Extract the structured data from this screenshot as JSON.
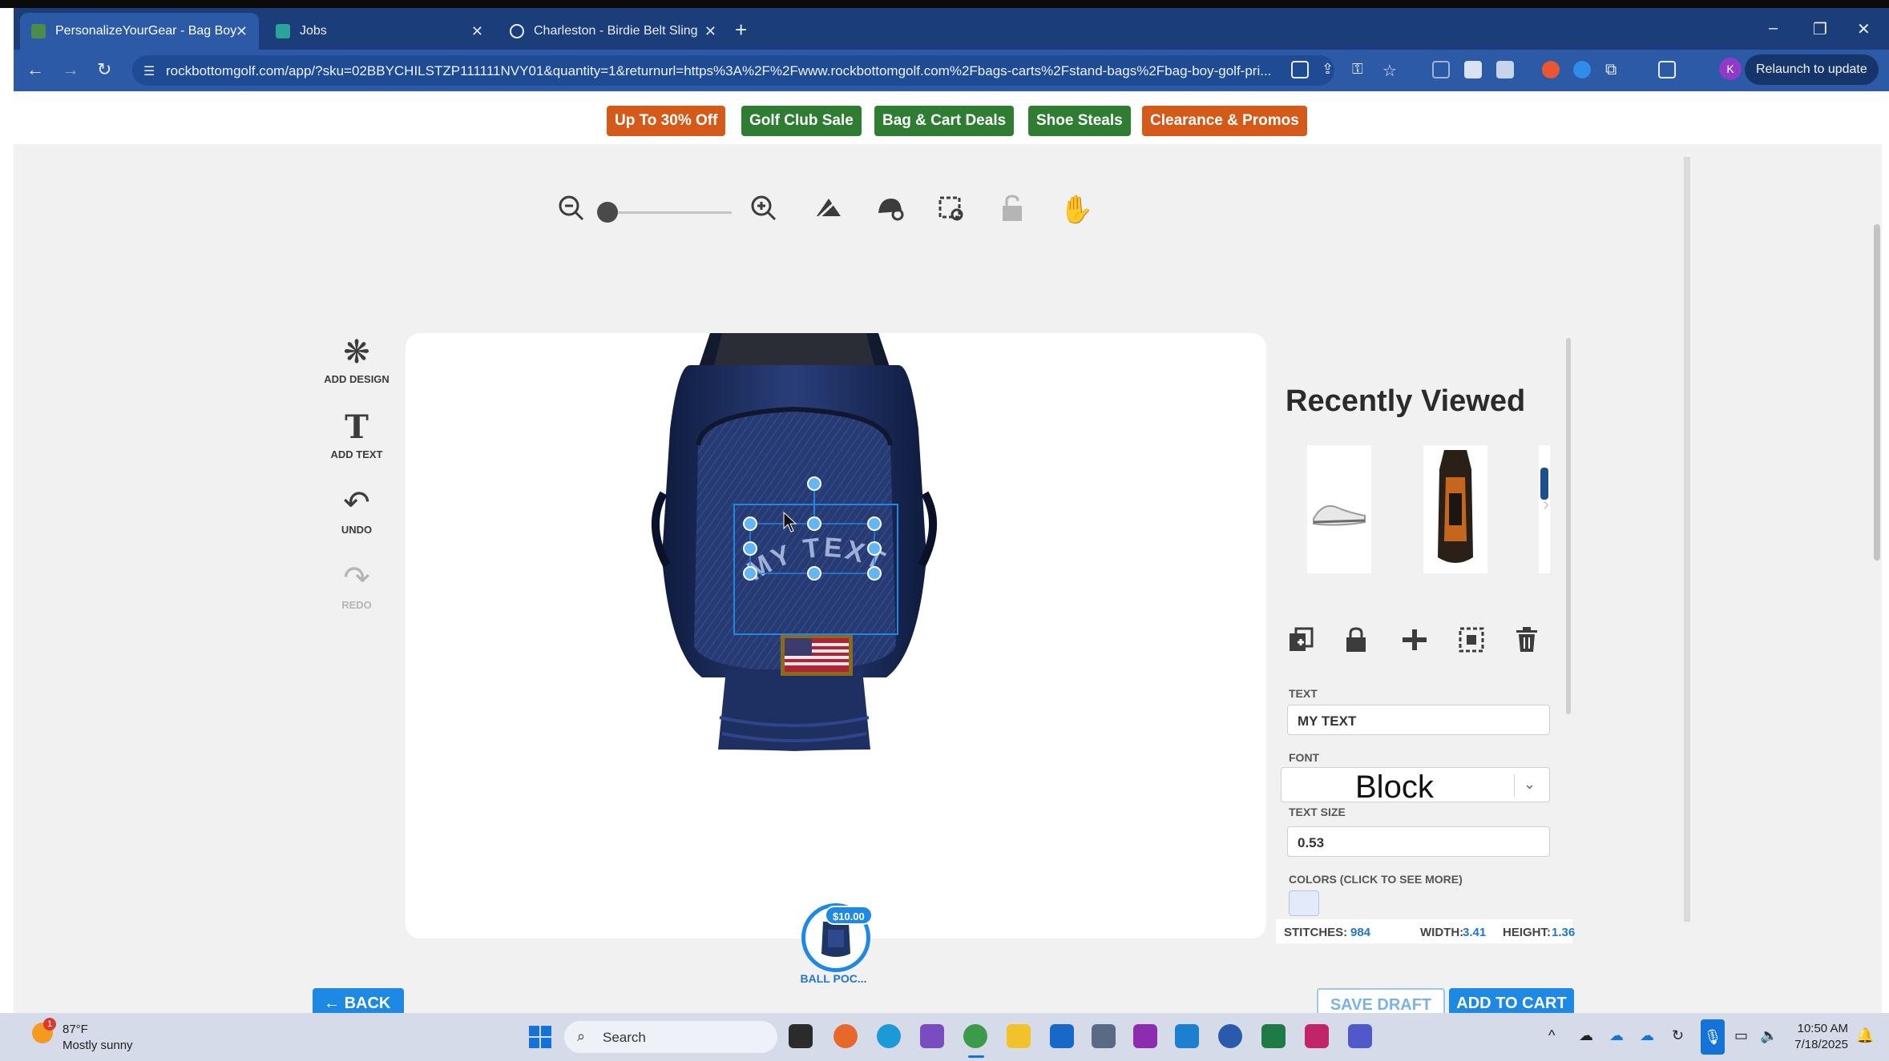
{
  "browser": {
    "tabs": [
      {
        "title": "PersonalizeYourGear - Bag Boy",
        "active": true
      },
      {
        "title": "Jobs",
        "active": false
      },
      {
        "title": "Charleston - Birdie Belt Sling Ba",
        "active": false
      }
    ],
    "url": "rockbottomgolf.com/app/?sku=02BBYCHILSTZP111111NVY01&quantity=1&returnurl=https%3A%2F%2Fwww.rockbottomgolf.com%2Fbags-carts%2Fstand-bags%2Fbag-boy-golf-pri...",
    "avatar_letter": "K",
    "relaunch_label": "Relaunch to update",
    "accent_color": "#2c5aa6"
  },
  "promo_bar": {
    "buttons": [
      {
        "label": "Up To 30% Off",
        "color": "#d45a1a"
      },
      {
        "label": "Golf Club Sale",
        "color": "#2e7d32"
      },
      {
        "label": "Bag & Cart Deals",
        "color": "#2e7d32"
      },
      {
        "label": "Shoe Steals",
        "color": "#2e7d32"
      },
      {
        "label": "Clearance & Promos",
        "color": "#d45a1a"
      }
    ]
  },
  "left_tools": {
    "add_design": "ADD DESIGN",
    "add_text": "ADD TEXT",
    "undo": "UNDO",
    "redo": "REDO"
  },
  "canvas": {
    "text_on_bag": "MY TEXT",
    "zoom_level": 0
  },
  "right_panel": {
    "recently_viewed_title": "Recently Viewed",
    "text_label": "TEXT",
    "text_value": "MY TEXT",
    "font_label": "FONT",
    "font_value": "Block",
    "text_size_label": "TEXT SIZE",
    "text_size_value": "0.53",
    "colors_label": "COLORS (CLICK TO SEE MORE)",
    "selected_color": "#e3ebfa"
  },
  "stats": {
    "stitches_label": "STITCHES:",
    "stitches_value": "984",
    "width_label": "WIDTH:",
    "width_value": "3.41",
    "height_label": "HEIGHT:",
    "height_value": "1.36"
  },
  "location_badge": {
    "price": "$10.00",
    "label": "BALL POC..."
  },
  "footer_buttons": {
    "back": "BACK",
    "save_draft": "SAVE DRAFT",
    "add_to_cart": "ADD TO CART"
  },
  "taskbar": {
    "weather_temp": "87°F",
    "weather_desc": "Mostly sunny",
    "weather_badge": "1",
    "search_label": "Search",
    "time": "10:50 AM",
    "date": "7/18/2025"
  }
}
